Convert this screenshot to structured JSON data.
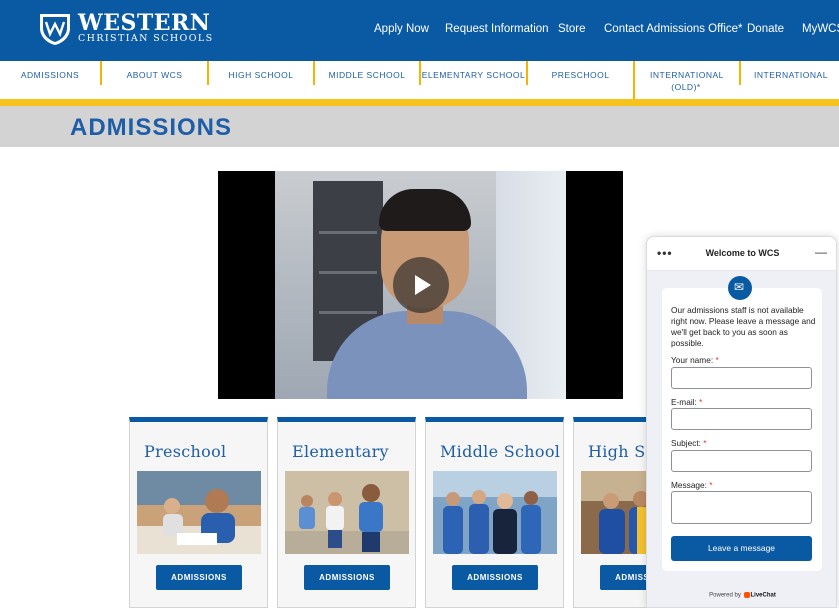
{
  "brand": {
    "name_line1": "WESTERN",
    "name_line2": "CHRISTIAN SCHOOLS",
    "primary": "#0a5aa3",
    "accent": "#f6c21c"
  },
  "topnav": [
    "Apply Now",
    "Request Information",
    "Store",
    "Contact Admissions Office*",
    "Donate",
    "MyWCS"
  ],
  "subnav": [
    "ADMISSIONS",
    "ABOUT WCS",
    "HIGH SCHOOL",
    "MIDDLE SCHOOL",
    "ELEMENTARY SCHOOL",
    "PRESCHOOL",
    "INTERNATIONAL (OLD)*",
    "INTERNATIONAL"
  ],
  "page_title": "ADMISSIONS",
  "video": {
    "play_icon": "play-icon"
  },
  "cards": [
    {
      "title": "Preschool",
      "button": "ADMISSIONS"
    },
    {
      "title": "Elementary",
      "button": "ADMISSIONS"
    },
    {
      "title": "Middle School",
      "button": "ADMISSIONS"
    },
    {
      "title": "High School",
      "button": "ADMISSIONS"
    }
  ],
  "chat": {
    "title": "Welcome to WCS",
    "message": "Our admissions staff is not available right now. Please leave a message and we'll get back to you as soon as possible.",
    "fields": [
      {
        "label": "Your name:",
        "value": ""
      },
      {
        "label": "E-mail:",
        "value": ""
      },
      {
        "label": "Subject:",
        "value": ""
      },
      {
        "label": "Message:",
        "value": ""
      }
    ],
    "required_mark": "*",
    "submit": "Leave a message",
    "powered_prefix": "Powered by",
    "powered_brand": "LiveChat"
  }
}
